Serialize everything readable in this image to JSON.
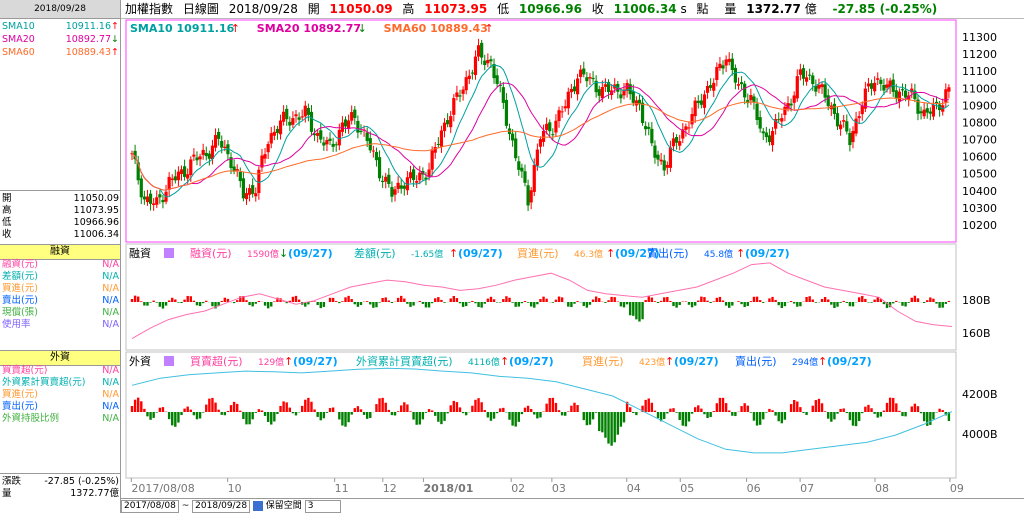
{
  "left_panel": {
    "date": "2018/09/28",
    "sma": [
      {
        "name": "SMA10",
        "value": "10911.16",
        "arrow": "↑",
        "color": "#00a0a0",
        "arrow_color": "#ff0000"
      },
      {
        "name": "SMA20",
        "value": "10892.77",
        "arrow": "↓",
        "color": "#e000a0",
        "arrow_color": "#008000"
      },
      {
        "name": "SMA60",
        "value": "10889.43",
        "arrow": "↑",
        "color": "#ff6a2a",
        "arrow_color": "#ff0000"
      }
    ],
    "ohlc": [
      {
        "label": "開",
        "value": "11050.09"
      },
      {
        "label": "高",
        "value": "11073.95"
      },
      {
        "label": "低",
        "value": "10966.96"
      },
      {
        "label": "收",
        "value": "11006.34"
      }
    ],
    "margin_title": "融資",
    "margin_rows": [
      {
        "label": "融資(元)",
        "value": "N/A",
        "color": "#ff3fa0"
      },
      {
        "label": "差額(元)",
        "value": "N/A",
        "color": "#00b0b0"
      },
      {
        "label": "買進(元)",
        "value": "N/A",
        "color": "#ff9a30"
      },
      {
        "label": "賣出(元)",
        "value": "N/A",
        "color": "#0060ff"
      },
      {
        "label": "現償(張)",
        "value": "N/A",
        "color": "#40b040"
      },
      {
        "label": "使用率",
        "value": "N/A",
        "color": "#8060ff"
      }
    ],
    "foreign_title": "外資",
    "foreign_rows": [
      {
        "label": "買賣超(元)",
        "value": "N/A",
        "color": "#ff3fa0"
      },
      {
        "label": "外資累計買賣超(元)",
        "value": "N/A",
        "color": "#00b0b0"
      },
      {
        "label": "買進(元)",
        "value": "N/A",
        "color": "#ff9a30"
      },
      {
        "label": "賣出(元)",
        "value": "N/A",
        "color": "#0060ff"
      },
      {
        "label": "外資持股比例",
        "value": "N/A",
        "color": "#40b040"
      }
    ],
    "change_label": "漲跌",
    "change_value": "-27.85 (-0.25%)",
    "volume_label": "量",
    "volume_value": "1372.77億"
  },
  "header": {
    "name": "加權指數",
    "chart_kind": "日線圖",
    "date": "2018/09/28",
    "open_label": "開",
    "open": "11050.09",
    "high_label": "高",
    "high": "11073.95",
    "low_label": "低",
    "low": "10966.96",
    "close_label": "收",
    "close": "11006.34",
    "s_label": "s",
    "pt_label": "點",
    "vol_label": "量",
    "vol": "1372.77",
    "vol_unit": "億",
    "change": "-27.85 (-0.25%)"
  },
  "bottom_bar": {
    "from": "2017/08/08",
    "tilde": "~",
    "to": "2018/09/28",
    "keep_label": "保留空間",
    "keep_value": "3"
  },
  "chart_data": [
    {
      "type": "candlestick",
      "legend": [
        {
          "name": "SMA10",
          "value": "10911.16",
          "arrow": "↑"
        },
        {
          "name": "SMA20",
          "value": "10892.77",
          "arrow": "↓"
        },
        {
          "name": "SMA60",
          "value": "10889.43",
          "arrow": "↑"
        }
      ],
      "ylim": [
        10100,
        11400
      ],
      "yticks": [
        10200,
        10300,
        10400,
        10500,
        10600,
        10700,
        10800,
        10900,
        11000,
        11100,
        11200,
        11300
      ],
      "x_tick_labels": [
        "2017/08/08",
        "10",
        "11",
        "12",
        "2018/01",
        "02",
        "03",
        "04",
        "05",
        "06",
        "07",
        "08",
        "09"
      ],
      "closes_approx": [
        10600,
        10350,
        10320,
        10450,
        10500,
        10580,
        10620,
        10700,
        10580,
        10380,
        10420,
        10700,
        10800,
        10830,
        10850,
        10720,
        10650,
        10780,
        10830,
        10690,
        10520,
        10380,
        10460,
        10470,
        10530,
        10750,
        10900,
        11050,
        11200,
        11150,
        10900,
        10600,
        10350,
        10720,
        10780,
        10900,
        11080,
        11050,
        10980,
        11000,
        10980,
        10900,
        10650,
        10540,
        10700,
        10800,
        10950,
        11040,
        11200,
        11000,
        10950,
        10700,
        10780,
        10900,
        11080,
        11050,
        10950,
        10820,
        10700,
        10920,
        11060,
        11000,
        10980,
        10950,
        10850,
        10880,
        11006
      ]
    },
    {
      "type": "bar",
      "title": "融資",
      "legend": [
        {
          "name": "融資(元)",
          "value": "1590億",
          "arrow": "↓",
          "date": "(09/27)"
        },
        {
          "name": "差額(元)",
          "value": "-1.65億",
          "arrow": "↑",
          "date": "(09/27)"
        },
        {
          "name": "買進(元)",
          "value": "46.3億",
          "arrow": "↑",
          "date": "(09/27)"
        },
        {
          "name": "賣出(元)",
          "value": "45.8億",
          "arrow": "↑",
          "date": "(09/27)"
        }
      ],
      "yticks": [
        "180B",
        "160B"
      ],
      "line_approx_billions": [
        152,
        158,
        163,
        166,
        168,
        172,
        176,
        178,
        175,
        172,
        174,
        178,
        182,
        184,
        186,
        185,
        183,
        182,
        180,
        181,
        183,
        186,
        188,
        190,
        186,
        180,
        178,
        177,
        176,
        178,
        180,
        182,
        186,
        190,
        195,
        196,
        190,
        186,
        182,
        180,
        178,
        176,
        168,
        162,
        160,
        159
      ]
    },
    {
      "type": "bar",
      "title": "外資",
      "legend": [
        {
          "name": "買賣超(元)",
          "value": "129億",
          "arrow": "↑",
          "date": "(09/27)"
        },
        {
          "name": "外資累計買賣超(元)",
          "value": "4116億",
          "arrow": "↑",
          "date": "(09/27)"
        },
        {
          "name": "買進(元)",
          "value": "423億",
          "arrow": "↑",
          "date": "(09/27)"
        },
        {
          "name": "賣出(元)",
          "value": "294億",
          "arrow": "↑",
          "date": "(09/27)"
        }
      ],
      "yticks": [
        "4200B",
        "4000B"
      ],
      "line_approx_billions": [
        4190,
        4210,
        4220,
        4225,
        4230,
        4228,
        4225,
        4230,
        4235,
        4238,
        4236,
        4230,
        4225,
        4215,
        4210,
        4200,
        4180,
        4160,
        4120,
        4080,
        4040,
        4010,
        4000,
        4000,
        4010,
        4020,
        4030,
        4050,
        4080,
        4116
      ]
    }
  ],
  "colors": {
    "up": "#ff0000",
    "down": "#008000",
    "frame": "#ff40ff",
    "label_blue": "#0000a0"
  }
}
